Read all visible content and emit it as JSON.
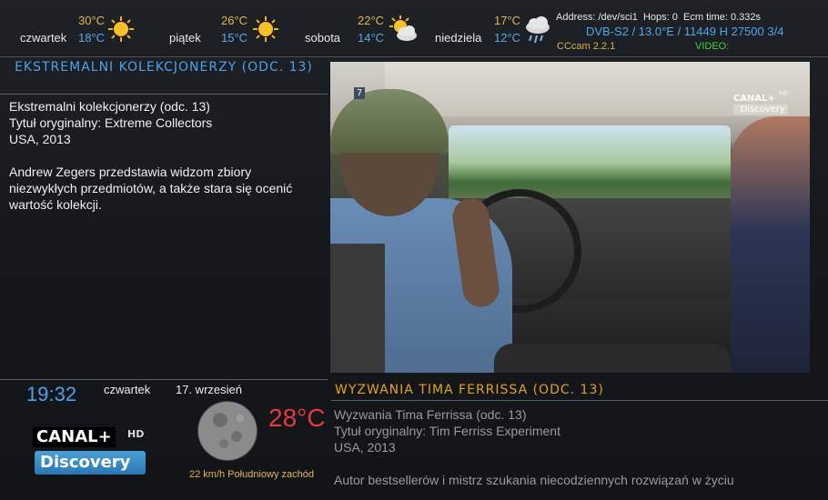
{
  "weather": {
    "days": [
      {
        "day": "czwartek",
        "high": "30°C",
        "low": "18°C",
        "icon": "sun-icon"
      },
      {
        "day": "piątek",
        "high": "26°C",
        "low": "15°C",
        "icon": "sun-icon"
      },
      {
        "day": "sobota",
        "high": "22°C",
        "low": "14°C",
        "icon": "partly-cloudy-icon"
      },
      {
        "day": "niedziela",
        "high": "17°C",
        "low": "12°C",
        "icon": "rain-icon"
      }
    ]
  },
  "signal": {
    "address_line": "Address: /dev/sci1  Hops: 0  Ecm time: 0.332s",
    "transponder": "DVB-S2 / 13.0°E / 11449 H 27500 3/4",
    "cam": "CCcam 2.2.1",
    "video_label": "VIDEO:"
  },
  "current": {
    "title": "EKSTREMALNI KOLEKCJONERZY (ODC. 13)",
    "line1": "Ekstremalni kolekcjonerzy (odc. 13)",
    "line2": "Tytuł oryginalny: Extreme Collectors",
    "line3": "USA, 2013",
    "description": "Andrew Zegers przedstawia widzom zbiory niezwykłych przedmiotów, a także stara się ocenić wartość kolekcji."
  },
  "video": {
    "channel_badge": "7",
    "logo_top": "CANAL+",
    "logo_hd": "HD",
    "logo_bottom": "Discovery"
  },
  "status": {
    "time": "19:32",
    "weekday": "czwartek",
    "date": "17. wrzesień",
    "temperature": "28°C",
    "wind": "22 km/h Południowy zachód",
    "moon_icon": "moon-icon"
  },
  "channel_logo": {
    "top": "CANAL+",
    "hd": "HD",
    "bottom": "Discovery"
  },
  "next": {
    "title": "WYZWANIA TIMA FERRISSA (ODC. 13)",
    "line1": "Wyzwania Tima Ferrissa (odc. 13)",
    "line2": "Tytuł oryginalny: Tim Ferriss Experiment",
    "line3": "USA, 2013",
    "description": "Autor bestsellerów i mistrz szukania niecodziennych rozwiązań w życiu"
  }
}
